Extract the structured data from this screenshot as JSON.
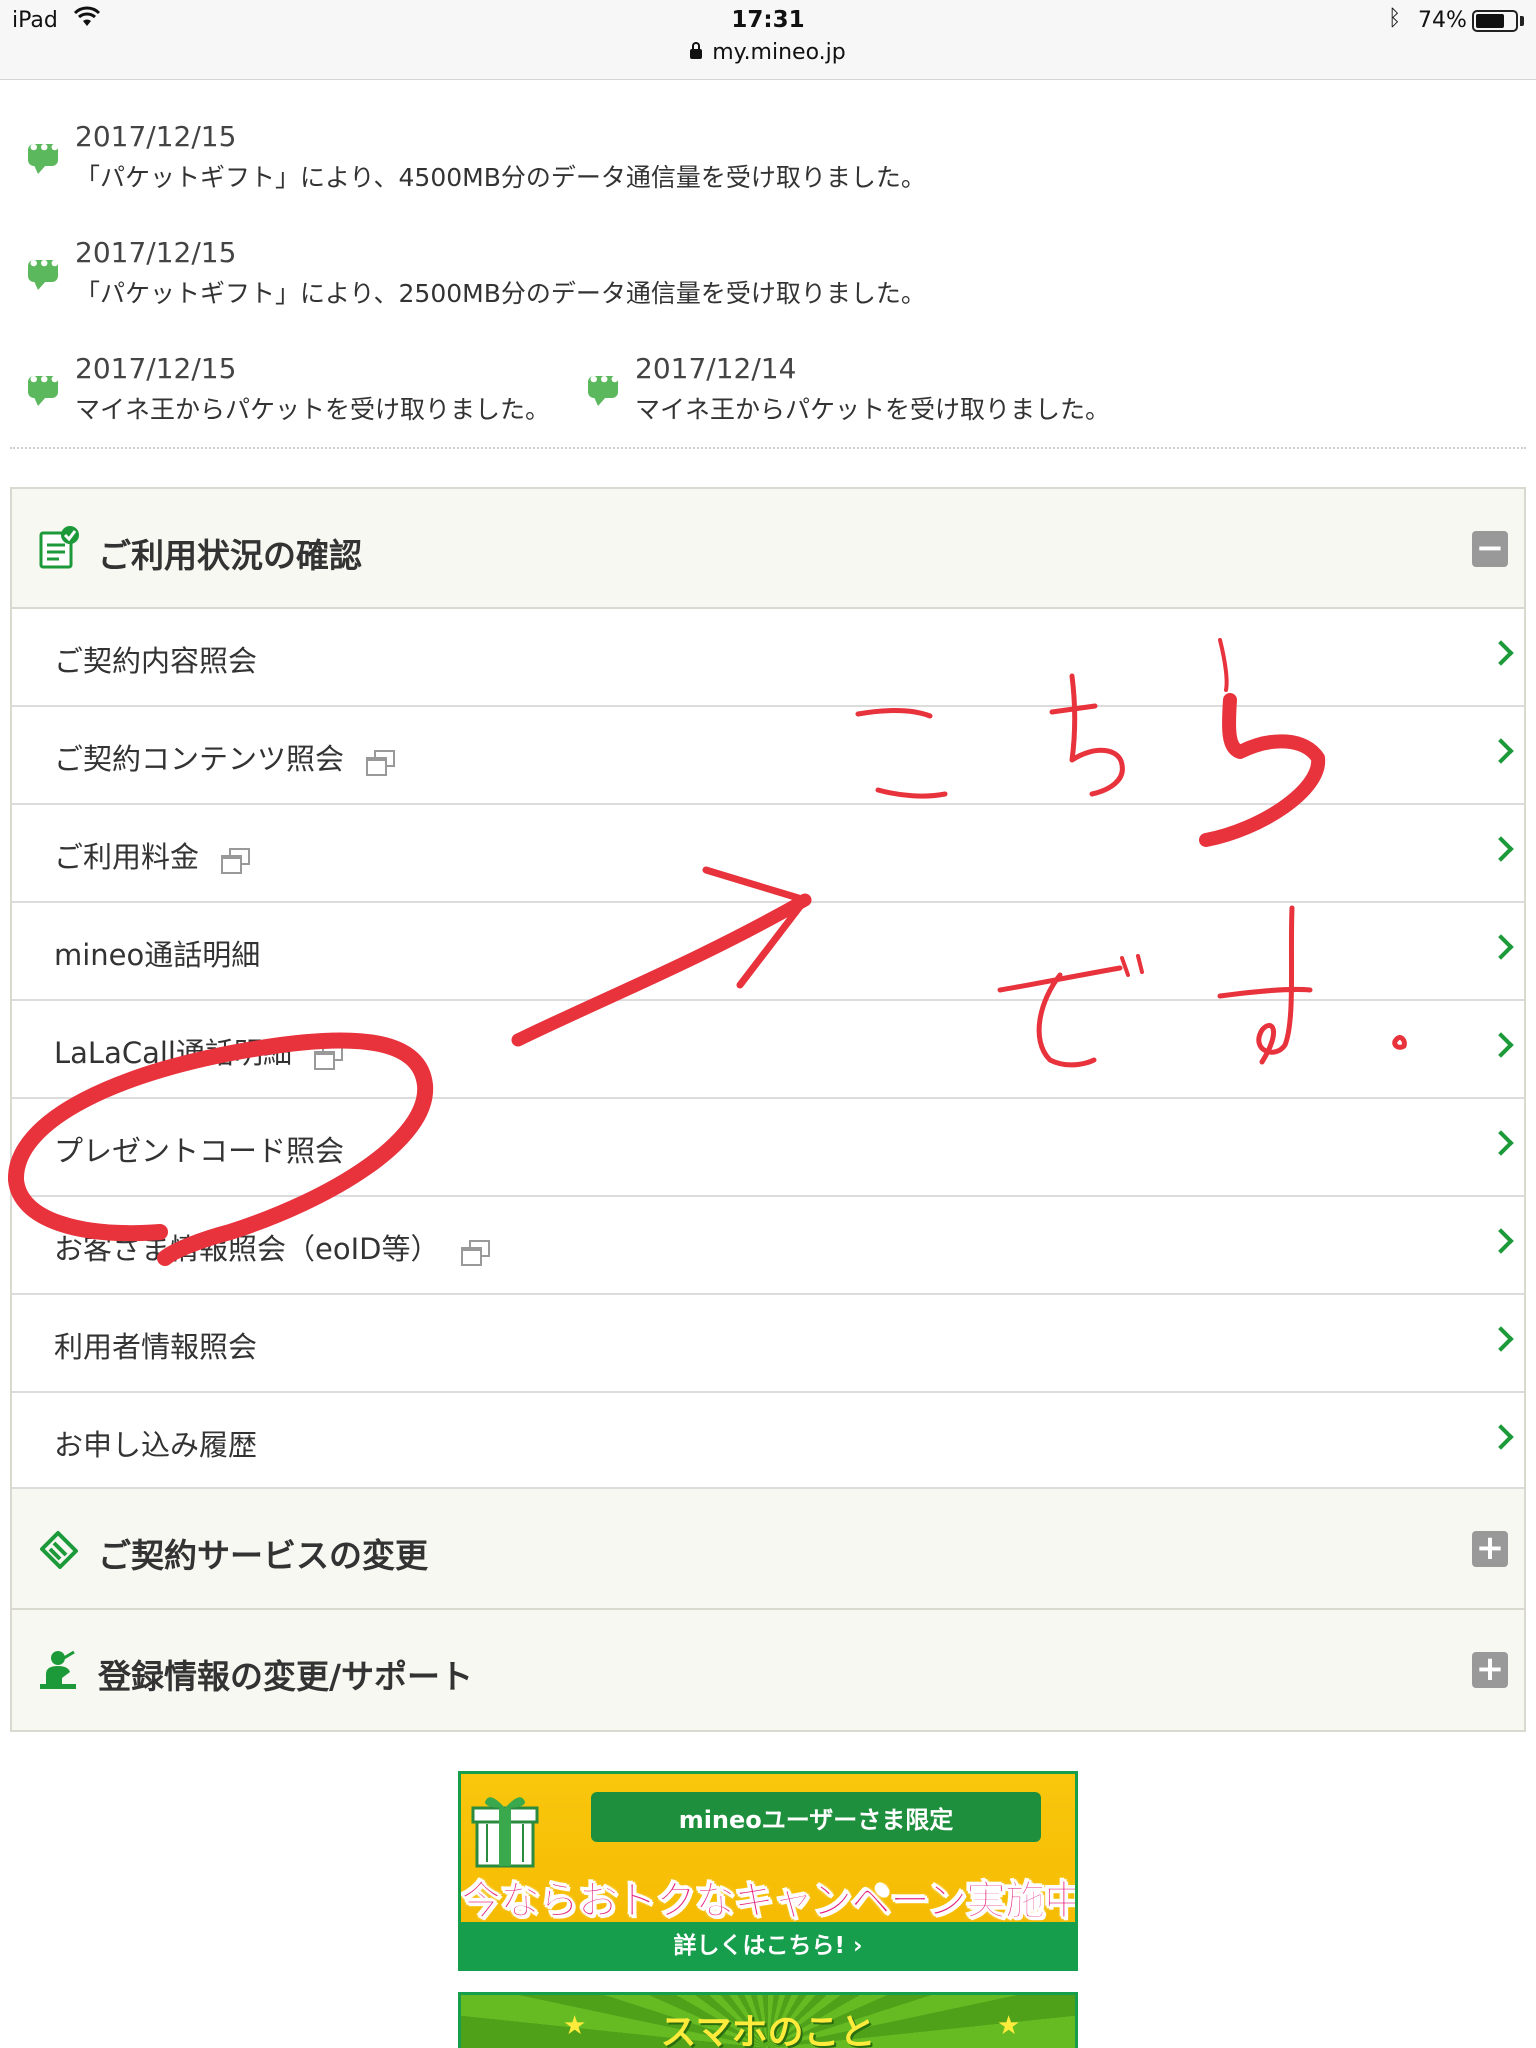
{
  "status_bar": {
    "device": "iPad",
    "time": "17:31",
    "battery": "74%",
    "battery_level": 0.74
  },
  "url": "my.mineo.jp",
  "notices": [
    {
      "date": "2017/12/15",
      "text": "「パケットギフト」により、4500MB分のデータ通信量を受け取りました。"
    },
    {
      "date": "2017/12/15",
      "text": "「パケットギフト」により、2500MB分のデータ通信量を受け取りました。"
    },
    {
      "date": "2017/12/15",
      "text": "マイネ王からパケットを受け取りました。"
    },
    {
      "date": "2017/12/14",
      "text": "マイネ王からパケットを受け取りました。"
    }
  ],
  "usage_section": {
    "title": "ご利用状況の確認",
    "toggle": "−",
    "items": [
      {
        "label": "ご契約内容照会"
      },
      {
        "label": "ご契約コンテンツ照会"
      },
      {
        "label": "ご利用料金"
      },
      {
        "label": "mineo通話明細"
      },
      {
        "label": "LaLaCall通話明細"
      },
      {
        "label": "プレゼントコード照会"
      },
      {
        "label": "お客さま情報照会（eoID等）"
      },
      {
        "label": "利用者情報照会"
      },
      {
        "label": "お申し込み履歴"
      }
    ]
  },
  "service_change_section": {
    "title": "ご契約サービスの変更",
    "toggle": "+"
  },
  "support_section": {
    "title": "登録情報の変更/サポート",
    "toggle": "+"
  },
  "banner_campaign": {
    "ribbon": "mineoユーザーさま限定",
    "headline": "今ならおトクなキャンペーン実施中!",
    "link": "詳しくはこちら! ›"
  },
  "banner_smartphone": {
    "headline": "スマホのこと"
  },
  "annotation": {
    "handwritten": "こちらです。",
    "color": "#e8323c"
  },
  "colors": {
    "accent_green": "#1c9a3a",
    "section_bg": "#f8f8f2",
    "notice_icon": "#5cb85c"
  }
}
